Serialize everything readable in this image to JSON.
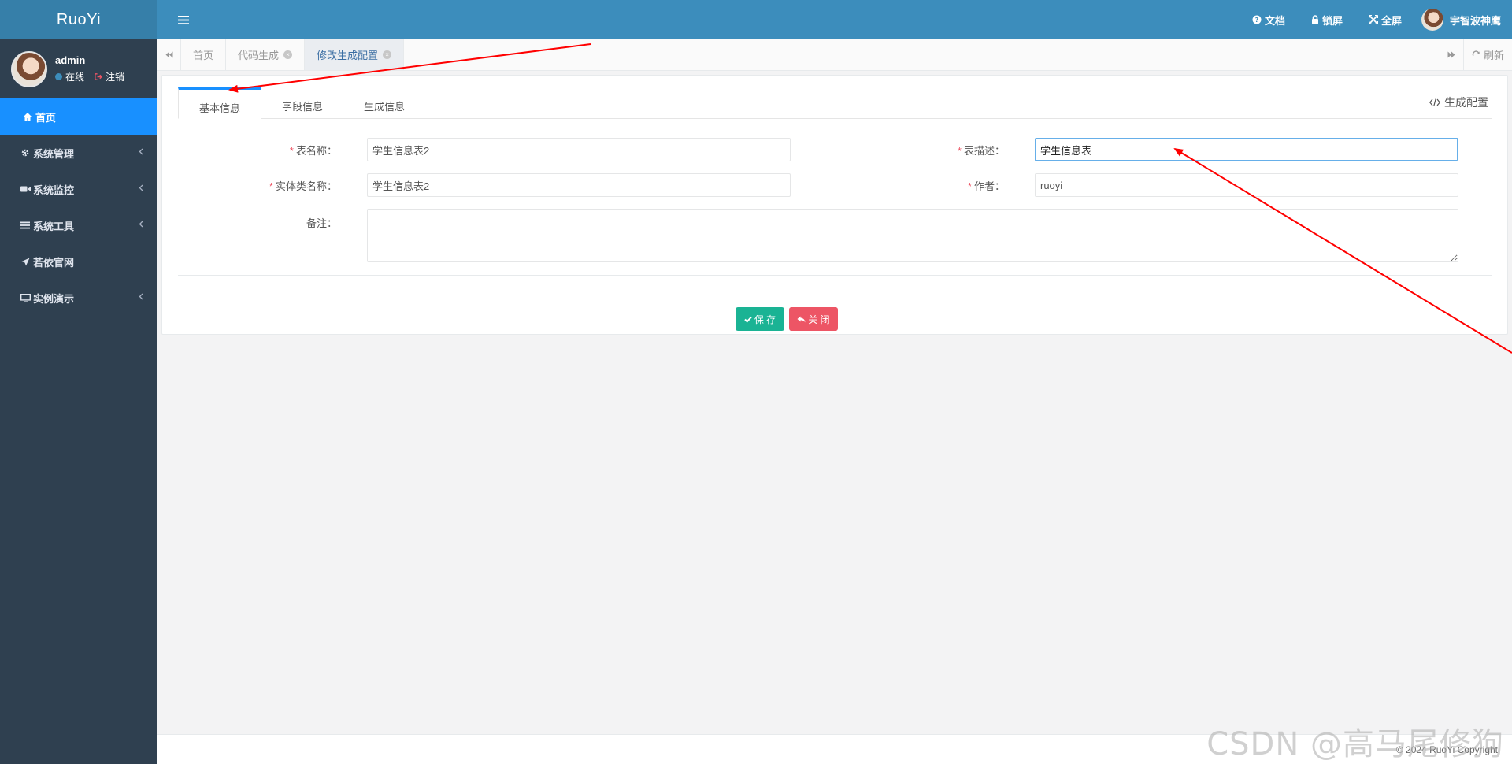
{
  "app": {
    "logo": "RuoYi"
  },
  "user": {
    "name": "admin",
    "status": "在线",
    "logout": "注销"
  },
  "sidebar": {
    "items": [
      {
        "label": "首页",
        "icon": "home-icon",
        "active": true
      },
      {
        "label": "系统管理",
        "icon": "gear-icon"
      },
      {
        "label": "系统监控",
        "icon": "video-icon"
      },
      {
        "label": "系统工具",
        "icon": "bars-icon"
      },
      {
        "label": "若依官网",
        "icon": "send-icon"
      },
      {
        "label": "实例演示",
        "icon": "desktop-icon"
      }
    ]
  },
  "topbar": {
    "docs": "文档",
    "lock": "锁屏",
    "fullscreen": "全屏",
    "username": "宇智波神鹰"
  },
  "tabs": {
    "items": [
      {
        "label": "首页"
      },
      {
        "label": "代码生成"
      },
      {
        "label": "修改生成配置"
      }
    ],
    "refresh": "刷新"
  },
  "form": {
    "tabs": [
      "基本信息",
      "字段信息",
      "生成信息"
    ],
    "gen_config": "生成配置",
    "table_name_label": "表名称：",
    "table_name_value": "学生信息表2",
    "table_desc_label": "表描述：",
    "table_desc_value": "学生信息表",
    "class_name_label": "实体类名称：",
    "class_name_value": "学生信息表2",
    "author_label": "作者：",
    "author_value": "ruoyi",
    "remark_label": "备注：",
    "remark_value": "",
    "save": "保 存",
    "close": "关 闭"
  },
  "footer": {
    "copyright": "© 2024 RuoYi Copyright"
  },
  "watermark": "CSDN @高马尾修狗",
  "colors": {
    "sidebar": "#2f4050",
    "topbar": "#3c8dbc",
    "active_menu": "#1890ff",
    "save_button": "#1ab394",
    "close_button": "#ed5565",
    "annotation_arrow": "#ff0000"
  }
}
